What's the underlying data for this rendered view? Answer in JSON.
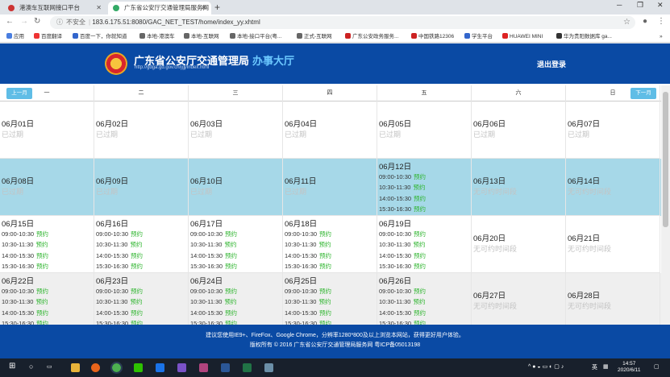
{
  "browser": {
    "tabs": [
      {
        "label": "港澳车互联网接口平台"
      },
      {
        "label": "广东省公安厅交通管理局服务网"
      }
    ],
    "new_tab": "+",
    "url_warning": "不安全",
    "url": "183.6.175.51:8080/GAC_NET_TEST/home/index_yy.xhtml",
    "bookmarks": [
      "应用",
      "百度翻译",
      "百度一下，你就知道",
      "本地-港澳车",
      "本地-互联网",
      "本地-接口平台(粤...",
      "正式-互联网",
      "广东公安政务服务...",
      "中国铁路12306",
      "学生平台",
      "HUAWEI MINI",
      "华为贵阳数据库 ga..."
    ]
  },
  "header": {
    "title": "广东省公安厅交通管理局",
    "title_hall": "办事大厅",
    "url": "http://gdga.gd.gov.cn/jgj/index.html",
    "logout": "退出登录"
  },
  "calendar": {
    "prev": "上一月",
    "next": "下一月",
    "weekdays": [
      "一",
      "二",
      "三",
      "四",
      "五",
      "六",
      "日"
    ],
    "weeks": [
      {
        "bg": "#ffffff",
        "cells": [
          {
            "date": "06月01日",
            "status": "已过期"
          },
          {
            "date": "06月02日",
            "status": "已过期"
          },
          {
            "date": "06月03日",
            "status": "已过期"
          },
          {
            "date": "06月04日",
            "status": "已过期"
          },
          {
            "date": "06月05日",
            "status": "已过期"
          },
          {
            "date": "06月06日",
            "status": "已过期"
          },
          {
            "date": "06月07日",
            "status": "已过期"
          }
        ]
      },
      {
        "bg": "#a6d8e8",
        "cells": [
          {
            "date": "06月08日",
            "status": "已过期"
          },
          {
            "date": "06月09日",
            "status": "已过期"
          },
          {
            "date": "06月10日",
            "status": "已过期"
          },
          {
            "date": "06月11日",
            "status": "已过期"
          },
          {
            "date": "06月12日",
            "slots": [
              "09:00-10:30",
              "10:30-11:30",
              "14:00-15:30",
              "15:30-16:30"
            ]
          },
          {
            "date": "06月13日",
            "status": "无可约时间段"
          },
          {
            "date": "06月14日",
            "status": "无可约时间段"
          }
        ]
      },
      {
        "bg": "#ffffff",
        "cells": [
          {
            "date": "06月15日",
            "slots": [
              "09:00-10:30",
              "10:30-11:30",
              "14:00-15:30",
              "15:30-16:30"
            ]
          },
          {
            "date": "06月16日",
            "slots": [
              "09:00-10:30",
              "10:30-11:30",
              "14:00-15:30",
              "15:30-16:30"
            ]
          },
          {
            "date": "06月17日",
            "slots": [
              "09:00-10:30",
              "10:30-11:30",
              "14:00-15:30",
              "15:30-16:30"
            ]
          },
          {
            "date": "06月18日",
            "slots": [
              "09:00-10:30",
              "10:30-11:30",
              "14:00-15:30",
              "15:30-16:30"
            ]
          },
          {
            "date": "06月19日",
            "slots": [
              "09:00-10:30",
              "10:30-11:30",
              "14:00-15:30",
              "15:30-16:30"
            ]
          },
          {
            "date": "06月20日",
            "status": "无可约时间段"
          },
          {
            "date": "06月21日",
            "status": "无可约时间段"
          }
        ]
      },
      {
        "bg": "#efefef",
        "cells": [
          {
            "date": "06月22日",
            "slots": [
              "09:00-10:30",
              "10:30-11:30",
              "14:00-15:30",
              "15:30-16:30"
            ]
          },
          {
            "date": "06月23日",
            "slots": [
              "09:00-10:30",
              "10:30-11:30",
              "14:00-15:30",
              "15:30-16:30"
            ]
          },
          {
            "date": "06月24日",
            "slots": [
              "09:00-10:30",
              "10:30-11:30",
              "14:00-15:30",
              "15:30-16:30"
            ]
          },
          {
            "date": "06月25日",
            "slots": [
              "09:00-10:30",
              "10:30-11:30",
              "14:00-15:30",
              "15:30-16:30"
            ]
          },
          {
            "date": "06月26日",
            "slots": [
              "09:00-10:30",
              "10:30-11:30",
              "14:00-15:30",
              "15:30-16:30"
            ]
          },
          {
            "date": "06月27日",
            "status": "无可约时间段"
          },
          {
            "date": "06月28日",
            "status": "无可约时间段"
          }
        ]
      }
    ],
    "book_label": "预约"
  },
  "footer": {
    "line1": "建议您使用IE9+、FireFox、Google Chrome，分辨率1280*800及以上浏览本网站，获得更好用户体验。",
    "line2": "版权所有 © 2016 广东省公安厅交通管理局服务网 粤ICP备05013198"
  },
  "taskbar": {
    "ime": "英",
    "time": "14:57",
    "date": "2020/6/11"
  }
}
